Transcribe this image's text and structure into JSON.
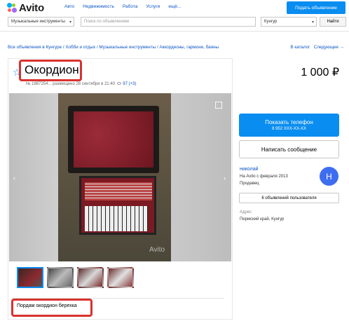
{
  "header": {
    "logo_text": "Avito",
    "nav": [
      "Авто",
      "Недвижимость",
      "Работа",
      "Услуги",
      "ещё..."
    ],
    "post_button": "Подать объявление"
  },
  "search": {
    "category": "Музыкальные инструменты",
    "placeholder": "Поиск по объявлениям",
    "region": "Кунгур",
    "find_button": "Найти"
  },
  "breadcrumb": "Все объявления в Кунгуре / Хобби и отдых / Музыкальные инструменты / Аккордеоны, гармони, баяны",
  "catalog_nav": {
    "catalog": "В каталог",
    "next": "Следующее →"
  },
  "listing": {
    "title": "Окордион",
    "price": "1 000 ₽",
    "meta_prefix": "№ 1887254... размещено 28 сентября в 21:40",
    "views": "97 (+3)",
    "description": "Пордам окордион берехка",
    "photo_watermark": "Avito"
  },
  "contact": {
    "phone_label": "Показать телефон",
    "phone_masked": "8 952 XXX-XX-XX",
    "message_button": "Написать сообщение"
  },
  "seller": {
    "name": "николай",
    "since": "На Avito с февраля 2013",
    "role": "Продавец",
    "avatar_letter": "Н",
    "all_ads": "6 объявлений пользователя"
  },
  "address": {
    "label": "Адрес",
    "value": "Пермский край, Кунгур"
  },
  "colors": {
    "accent": "#0a8df0",
    "link": "#0a55c5",
    "highlight": "#d9322f"
  }
}
